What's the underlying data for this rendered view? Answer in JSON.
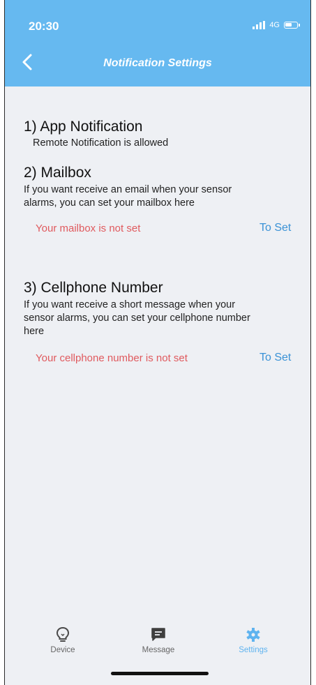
{
  "status_bar": {
    "time": "20:30",
    "network": "4G"
  },
  "nav": {
    "title": "Notification Settings",
    "back_icon": "chevron-left-icon"
  },
  "sections": {
    "app": {
      "heading": "1) App Notification",
      "text": "Remote Notification is allowed"
    },
    "mailbox": {
      "heading": "2) Mailbox",
      "text_line1": "If you want receive an email when your sensor",
      "text_line2": "alarms, you can set your mailbox here",
      "status": "Your mailbox is not set",
      "action": "To Set"
    },
    "cellphone": {
      "heading": "3) Cellphone Number",
      "text_line1": "If you want receive a short message when your",
      "text_line2": "sensor alarms, you can set your cellphone number",
      "text_line3": "here",
      "status": "Your cellphone number is not set",
      "action": "To Set"
    }
  },
  "tabs": [
    {
      "label": "Device",
      "icon": "lightbulb-icon"
    },
    {
      "label": "Message",
      "icon": "message-icon"
    },
    {
      "label": "Settings",
      "icon": "gear-icon",
      "active": true
    }
  ],
  "colors": {
    "header": "#66b9f0",
    "background": "#eef0f4",
    "warning": "#e05a5e",
    "link": "#3a92d6",
    "active_tab": "#5fb3ef"
  }
}
